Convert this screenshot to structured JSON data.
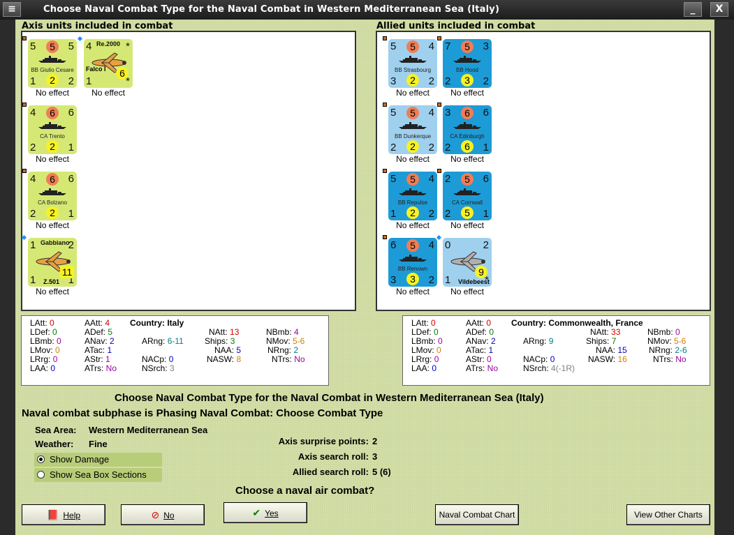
{
  "window": {
    "title": "Choose Naval Combat Type for the Naval Combat in Western Mediterranean Sea (Italy)",
    "min_label": "_",
    "close_label": "X"
  },
  "axis": {
    "title": "Axis units included in combat",
    "units": [
      {
        "name": "BB Giulio Cesare",
        "tl": "5",
        "top": "5",
        "tr": "5",
        "bl": "1",
        "bottom": "2",
        "br": "2",
        "effect": "No effect",
        "kind": "ship",
        "color": "axis"
      },
      {
        "name": "Falco I",
        "plane_label": "Re.2000",
        "tl": "4",
        "tr": "*",
        "bl": "1",
        "bottom": "6",
        "br": "*",
        "effect": "No effect",
        "kind": "plane",
        "color": "axis"
      },
      {
        "name": "CA Trento",
        "tl": "4",
        "top": "6",
        "tr": "6",
        "bl": "2",
        "bottom": "2",
        "br": "1",
        "effect": "No effect",
        "kind": "ship",
        "color": "axis"
      },
      {
        "name": "CA Bolzano",
        "tl": "4",
        "top": "6",
        "tr": "6",
        "bl": "2",
        "bottom": "2",
        "br": "1",
        "effect": "No effect",
        "kind": "ship",
        "color": "axis"
      },
      {
        "name": "Z.501",
        "plane_label": "Gabbiano",
        "tl": "1",
        "tr": "2",
        "bl": "1",
        "bottom": "11",
        "br": "1",
        "effect": "No effect",
        "kind": "plane",
        "color": "axis"
      }
    ]
  },
  "allied": {
    "title": "Allied units included in combat",
    "units": [
      {
        "name": "BB Strasbourg",
        "tl": "5",
        "top": "5",
        "tr": "4",
        "bl": "3",
        "bottom": "2",
        "br": "2",
        "effect": "No effect",
        "color": "lb"
      },
      {
        "name": "BB Hood",
        "tl": "7",
        "top": "5",
        "tr": "3",
        "bl": "2",
        "bottom": "3",
        "br": "2",
        "effect": "No effect",
        "color": "db"
      },
      {
        "name": "BB Dunkerque",
        "tl": "5",
        "top": "5",
        "tr": "4",
        "bl": "2",
        "bottom": "2",
        "br": "2",
        "effect": "No effect",
        "color": "lb"
      },
      {
        "name": "CA Edinburgh",
        "tl": "3",
        "top": "6",
        "tr": "6",
        "bl": "2",
        "bottom": "6",
        "br": "1",
        "effect": "No effect",
        "color": "db"
      },
      {
        "name": "BB Repulse",
        "tl": "5",
        "top": "5",
        "tr": "4",
        "bl": "1",
        "bottom": "2",
        "br": "2",
        "effect": "No effect",
        "color": "db"
      },
      {
        "name": "CA Cornwall",
        "tl": "2",
        "top": "5",
        "tr": "6",
        "bl": "2",
        "bottom": "5",
        "br": "1",
        "effect": "No effect",
        "color": "db"
      },
      {
        "name": "BB Renown",
        "tl": "6",
        "top": "5",
        "tr": "4",
        "bl": "3",
        "bottom": "3",
        "br": "2",
        "effect": "No effect",
        "color": "db"
      },
      {
        "name": "Vildebeest",
        "tl": "0",
        "tr": "2",
        "bl": "1",
        "bottom": "9",
        "br": "*",
        "effect": "No effect",
        "color": "lb",
        "kind": "plane"
      }
    ]
  },
  "axis_stats": {
    "country_label": "Country:",
    "country": "Italy",
    "LAtt": "0",
    "LDef": "0",
    "LBmb": "0",
    "LMov": "0",
    "LRrg": "0",
    "LAA": "0",
    "AAtt": "4",
    "ADef": "5",
    "ANav": "2",
    "ATac": "1",
    "AStr": "1",
    "ATrs": "No",
    "ARng": "6-11",
    "NACp": "0",
    "NSrch": "3",
    "NAtt": "13",
    "Ships": "3",
    "NAA": "5",
    "NASW": "8",
    "NBmb": "4",
    "NMov": "5-6",
    "NRng": "2",
    "NTrs": "No"
  },
  "allied_stats": {
    "country_label": "Country:",
    "country": "Commonwealth, France",
    "LAtt": "0",
    "LDef": "0",
    "LBmb": "0",
    "LMov": "0",
    "LRrg": "0",
    "LAA": "0",
    "AAtt": "0",
    "ADef": "0",
    "ANav": "2",
    "ATac": "1",
    "AStr": "0",
    "ATrs": "No",
    "ARng": "9",
    "NACp": "0",
    "NSrch": "4(-1R)",
    "NAtt": "33",
    "Ships": "7",
    "NAA": "15",
    "NASW": "16",
    "NBmb": "0",
    "NMov": "5-6",
    "NRng": "2-6",
    "NTrs": "No"
  },
  "heading": "Choose Naval Combat Type for the Naval Combat in Western Mediterranean Sea (Italy)",
  "subphase": "Naval combat subphase is Phasing Naval Combat: Choose Combat Type",
  "sea_area_label": "Sea Area:",
  "sea_area": "Western Mediterranean Sea",
  "weather_label": "Weather:",
  "weather": "Fine",
  "show_damage": "Show Damage",
  "show_sea_box": "Show Sea Box Sections",
  "axis_surprise_label": "Axis surprise points:",
  "axis_surprise": "2",
  "axis_search_label": "Axis search roll:",
  "axis_search": "3",
  "allied_search_label": "Allied search roll:",
  "allied_search": "5 (6)",
  "question": "Choose a naval air combat?",
  "buttons": {
    "help": "Help",
    "no": "No",
    "yes": "Yes",
    "chart": "Naval Combat Chart",
    "other": "View Other Charts"
  },
  "colors": {
    "axis_counter": "#d6e874",
    "allied_light": "#9fd0ee",
    "allied_dark": "#1d9bd6",
    "red": "#d00000",
    "green": "#008000",
    "blue": "#0000c0",
    "teal": "#008080",
    "purple": "#a000a0",
    "orange": "#d08000",
    "gray": "#808080"
  }
}
